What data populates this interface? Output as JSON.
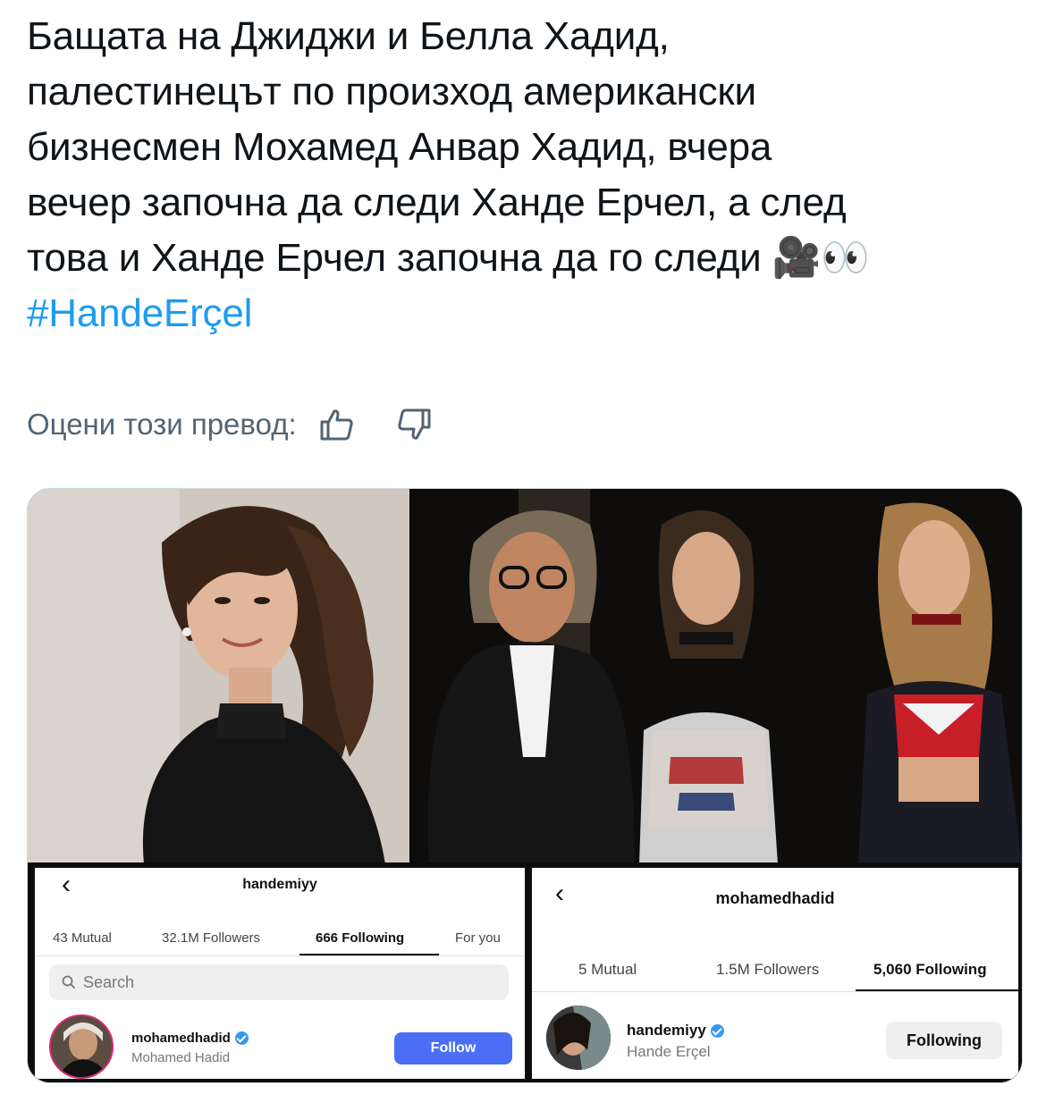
{
  "tweet": {
    "lines": [
      "Бащата на Джиджи и Белла Хадид,",
      "палестинецът по произход американски",
      "бизнесмен Мохамед Анвар Хадид, вчера",
      "вечер започна да следи Ханде Ерчел, а след",
      "това и Ханде Ерчел започна да го следи"
    ],
    "emoji_camera": "🎥",
    "emoji_eyes": "👀",
    "hashtag": "#HandeErçel"
  },
  "translation_rating": {
    "label": "Оцени този превод:",
    "thumbs_up_icon": "thumbs-up-icon",
    "thumbs_down_icon": "thumbs-down-icon"
  },
  "media": {
    "left_profile": {
      "username": "handemiyy",
      "tabs": [
        "43 Mutual",
        "32.1M Followers",
        "666 Following",
        "For you"
      ],
      "active_tab": "666 Following",
      "search_placeholder": "Search",
      "row": {
        "name": "mohamedhadid",
        "subname": "Mohamed Hadid",
        "button": "Follow"
      }
    },
    "right_profile": {
      "username": "mohamedhadid",
      "tabs": [
        "5 Mutual",
        "1.5M Followers",
        "5,060 Following"
      ],
      "active_tab": "5,060 Following",
      "row": {
        "name": "handemiyy",
        "subname": "Hande Erçel",
        "button": "Following"
      }
    }
  },
  "colors": {
    "link": "#1d9bf0",
    "muted": "#536471",
    "follow_button": "#4c6ef5",
    "verified": "#3897f0"
  }
}
